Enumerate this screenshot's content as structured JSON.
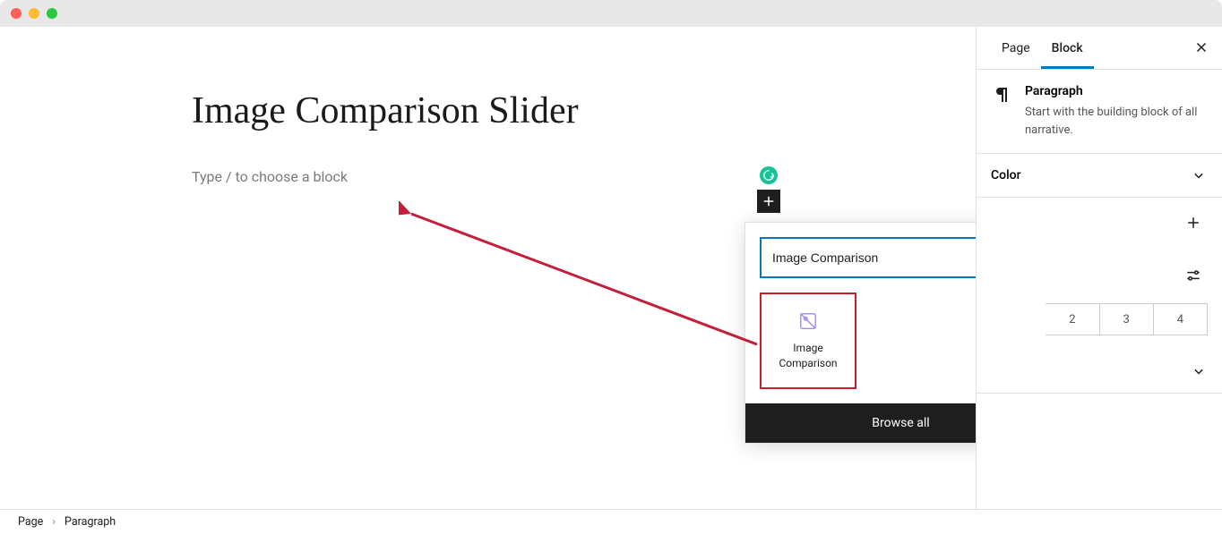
{
  "editor": {
    "page_title": "Image Comparison Slider",
    "placeholder": "Type / to choose a block"
  },
  "inserter": {
    "search_value": "Image Comparison",
    "result_label": "Image\nComparison",
    "browse_all": "Browse all"
  },
  "sidebar": {
    "tabs": {
      "page": "Page",
      "block": "Block"
    },
    "block_info": {
      "title": "Paragraph",
      "description": "Start with the building block of all narrative."
    },
    "panels": {
      "color": "Color"
    },
    "numbers": [
      "2",
      "3",
      "4"
    ]
  },
  "breadcrumb": {
    "root": "Page",
    "current": "Paragraph"
  }
}
